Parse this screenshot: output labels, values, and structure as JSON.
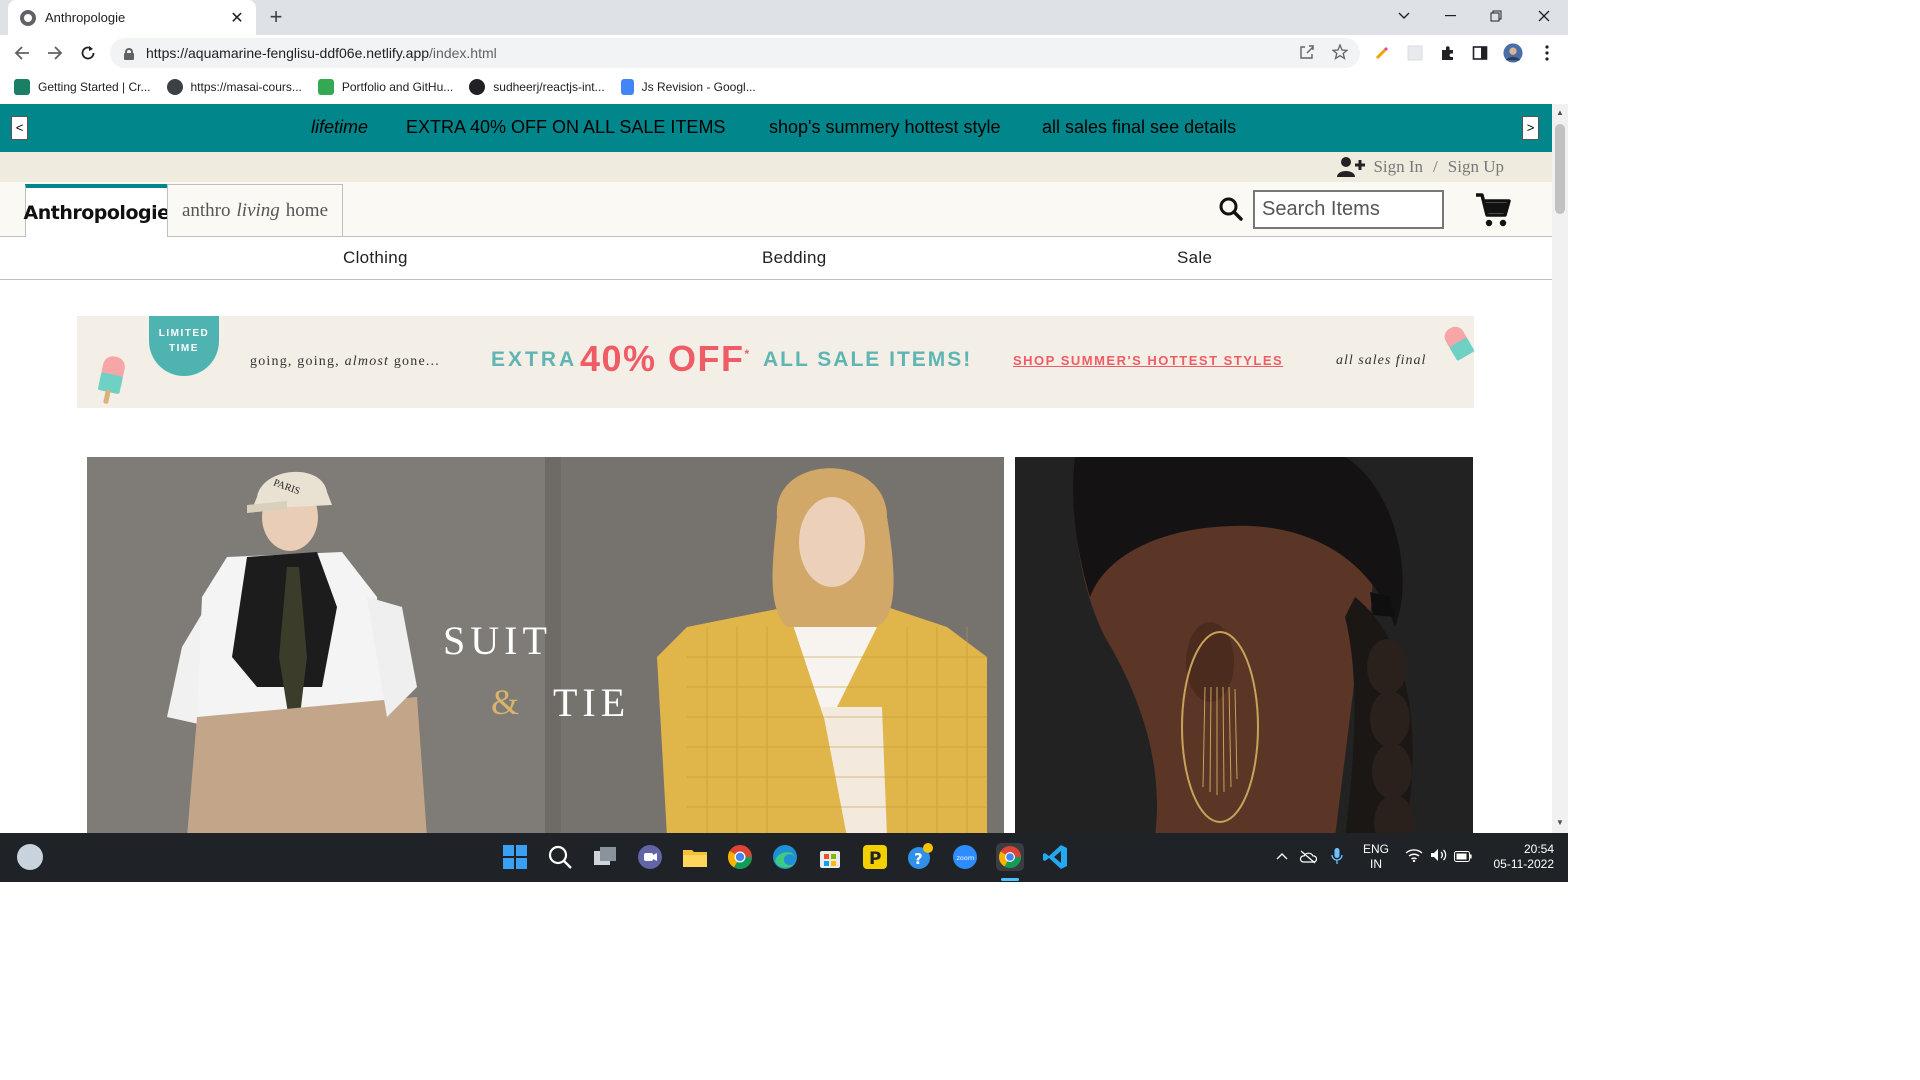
{
  "browser": {
    "tab_title": "Anthropologie",
    "url_host": "https://aquamarine-fenglisu-ddf06e.netlify.app",
    "url_path": "/index.html",
    "bookmarks": [
      {
        "label": "Getting Started | Cr...",
        "color": "#1a7f64"
      },
      {
        "label": "https://masai-cours...",
        "color": "#3c4043"
      },
      {
        "label": "Portfolio and GitHu...",
        "color": "#34a853"
      },
      {
        "label": "sudheerj/reactjs-int...",
        "color": "#202124"
      },
      {
        "label": "Js Revision - Googl...",
        "color": "#4285f4"
      }
    ]
  },
  "promo": {
    "prev": "<",
    "next": ">",
    "items": [
      "lifetime",
      "EXTRA 40% OFF ON ALL SALE ITEMS",
      "shop's summery hottest style",
      "all sales final see details"
    ],
    "bg_color": "#00868b"
  },
  "auth": {
    "sign_in": "Sign In",
    "separator": "/",
    "sign_up": "Sign Up"
  },
  "header": {
    "brand": "Anthropologie",
    "anthro_living": {
      "a": "anthro",
      "b": "living",
      "c": "home"
    },
    "search_placeholder": "Search Items"
  },
  "nav": {
    "categories": [
      "Clothing",
      "Bedding",
      "Sale"
    ]
  },
  "banner": {
    "badge_line1": "LIMITED",
    "badge_line2": "TIME",
    "going_a": "going, going,",
    "going_b": "almost",
    "going_c": "gone...",
    "extra": "EXTRA",
    "percent": "40% OFF",
    "star": "*",
    "all_sale": "ALL SALE ITEMS!",
    "shop": "SHOP SUMMER'S HOTTEST STYLES",
    "final": "all sales final",
    "teal": "#5fb5b3",
    "coral": "#f05c66"
  },
  "hero": {
    "suit": "SUIT",
    "amp": "&",
    "tie": "TIE",
    "cap_text": "PARIS"
  },
  "taskbar": {
    "lang_top": "ENG",
    "lang_bottom": "IN",
    "time": "20:54",
    "date": "05-11-2022",
    "zoom_label": "zoom"
  }
}
